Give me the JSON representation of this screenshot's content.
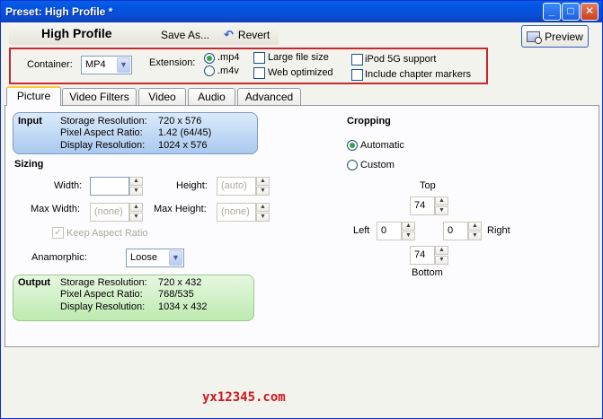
{
  "window": {
    "title": "Preset: High Profile *",
    "controls": [
      "minimize-icon",
      "maximize-icon",
      "close-icon"
    ]
  },
  "toolbar": {
    "preset_name": "High Profile",
    "save_as": "Save As...",
    "revert": "Revert",
    "preview": "Preview"
  },
  "container_section": {
    "container_label": "Container:",
    "container_value": "MP4",
    "extension_label": "Extension:",
    "ext_mp4": ".mp4",
    "ext_m4v": ".m4v",
    "large_file": "Large file size",
    "web_optimized": "Web optimized",
    "ipod": "iPod 5G support",
    "chapter_markers": "Include chapter markers"
  },
  "tabs": [
    "Picture",
    "Video Filters",
    "Video",
    "Audio",
    "Advanced"
  ],
  "input": {
    "title": "Input",
    "storage_label": "Storage Resolution:",
    "storage_value": "720 x 576",
    "par_label": "Pixel Aspect Ratio:",
    "par_value": "1.42 (64/45)",
    "display_label": "Display Resolution:",
    "display_value": "1024 x 576"
  },
  "sizing": {
    "title": "Sizing",
    "width_label": "Width:",
    "width_value": "",
    "height_label": "Height:",
    "height_value": "(auto)",
    "max_width_label": "Max Width:",
    "max_width_value": "(none)",
    "max_height_label": "Max Height:",
    "max_height_value": "(none)",
    "keep_aspect": "Keep Aspect Ratio",
    "anamorphic_label": "Anamorphic:",
    "anamorphic_value": "Loose"
  },
  "output": {
    "title": "Output",
    "storage_label": "Storage Resolution:",
    "storage_value": "720 x 432",
    "par_label": "Pixel Aspect Ratio:",
    "par_value": "768/535",
    "display_label": "Display Resolution:",
    "display_value": "1034 x 432"
  },
  "cropping": {
    "title": "Cropping",
    "automatic": "Automatic",
    "custom": "Custom",
    "top_label": "Top",
    "top_value": "74",
    "left_label": "Left",
    "left_value": "0",
    "right_label": "Right",
    "right_value": "0",
    "bottom_label": "Bottom",
    "bottom_value": "74"
  },
  "watermark": "yx12345.com"
}
